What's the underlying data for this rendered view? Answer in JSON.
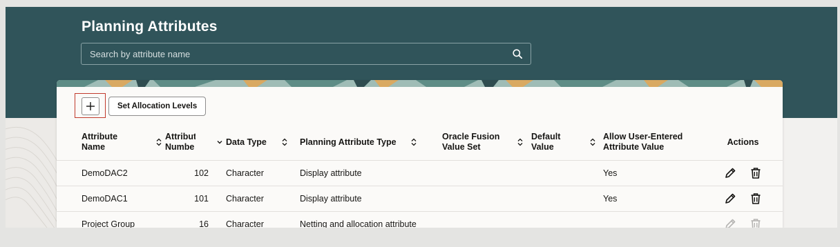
{
  "page": {
    "title": "Planning Attributes",
    "search": {
      "placeholder": "Search by attribute name",
      "value": ""
    }
  },
  "toolbar": {
    "add_icon": "plus-icon",
    "set_allocation_label": "Set Allocation Levels"
  },
  "table": {
    "columns": [
      {
        "line1": "Attribute",
        "line2": "Name",
        "sort_icon": "sort-both-icon"
      },
      {
        "line1": "Attribut",
        "line2": "Numbe",
        "sort_icon": "sort-descending-icon"
      },
      {
        "line1": "Data Type",
        "line2": "",
        "sort_icon": "sort-both-icon"
      },
      {
        "line1": "Planning Attribute Type",
        "line2": "",
        "sort_icon": "sort-both-icon"
      },
      {
        "line1": "Oracle Fusion",
        "line2": "Value Set",
        "sort_icon": "sort-both-icon"
      },
      {
        "line1": "Default",
        "line2": "Value",
        "sort_icon": "sort-both-icon"
      },
      {
        "line1": "Allow User-Entered",
        "line2": "Attribute Value"
      },
      {
        "line1": "Actions",
        "line2": ""
      }
    ],
    "rows": [
      {
        "name": "DemoDAC2",
        "number": "102",
        "data_type": "Character",
        "planning_type": "Display attribute",
        "value_set": "",
        "default_value": "",
        "allow_user": "Yes",
        "actions_enabled": true
      },
      {
        "name": "DemoDAC1",
        "number": "101",
        "data_type": "Character",
        "planning_type": "Display attribute",
        "value_set": "",
        "default_value": "",
        "allow_user": "Yes",
        "actions_enabled": true
      },
      {
        "name": "Project Group",
        "number": "16",
        "data_type": "Character",
        "planning_type": "Netting and allocation attribute",
        "value_set": "",
        "default_value": "",
        "allow_user": "",
        "actions_enabled": false
      }
    ],
    "action_icons": [
      "pencil-edit-icon",
      "trash-delete-icon"
    ]
  },
  "colors": {
    "header_bg": "#30545a",
    "panel_bg": "#fbfaf8",
    "page_bg": "#e4e4e2",
    "focus_ring": "#c0392b",
    "text": "#161513"
  }
}
